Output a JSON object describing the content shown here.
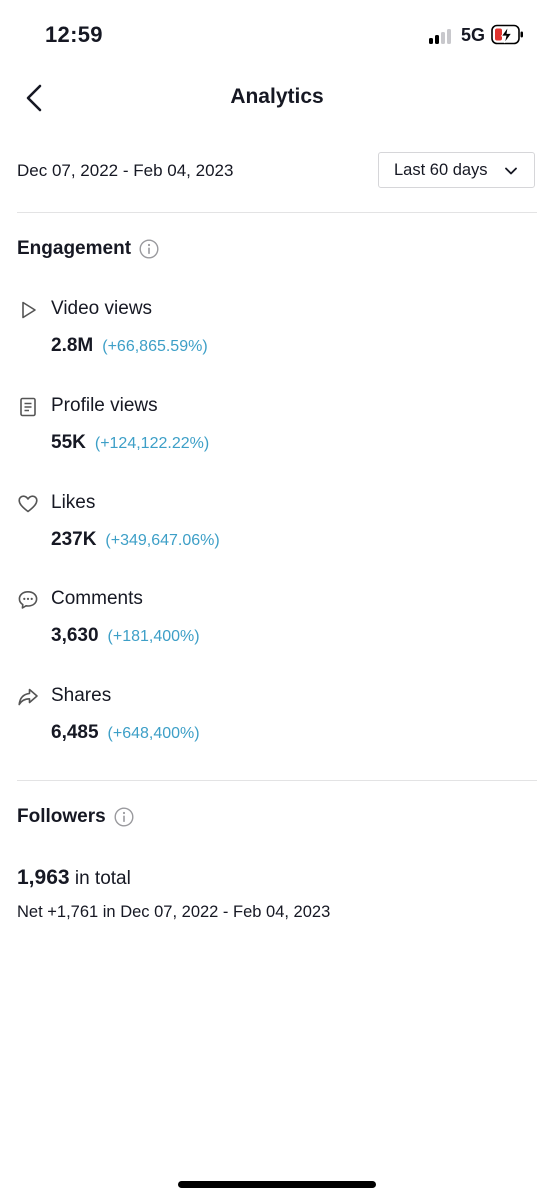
{
  "status_bar": {
    "time": "12:59",
    "network": "5G",
    "battery_color": "#e0332f"
  },
  "header": {
    "title": "Analytics",
    "back_icon": "chevron-left-icon"
  },
  "date_range": "Dec 07, 2022 - Feb 04, 2023",
  "period_select": {
    "selected": "Last 60 days"
  },
  "engagement": {
    "title": "Engagement",
    "metrics": [
      {
        "icon": "play-icon",
        "label": "Video views",
        "value": "2.8M",
        "change": "(+66,865.59%)"
      },
      {
        "icon": "profile-doc-icon",
        "label": "Profile views",
        "value": "55K",
        "change": "(+124,122.22%)"
      },
      {
        "icon": "heart-icon",
        "label": "Likes",
        "value": "237K",
        "change": "(+349,647.06%)"
      },
      {
        "icon": "comment-icon",
        "label": "Comments",
        "value": "3,630",
        "change": "(+181,400%)"
      },
      {
        "icon": "share-icon",
        "label": "Shares",
        "value": "6,485",
        "change": "(+648,400%)"
      }
    ]
  },
  "followers": {
    "title": "Followers",
    "total": "1,963",
    "total_suffix": "in total",
    "net": "Net +1,761 in Dec 07, 2022 - Feb 04, 2023"
  },
  "colors": {
    "accent_change": "#3d9fc7",
    "text": "#161823"
  }
}
